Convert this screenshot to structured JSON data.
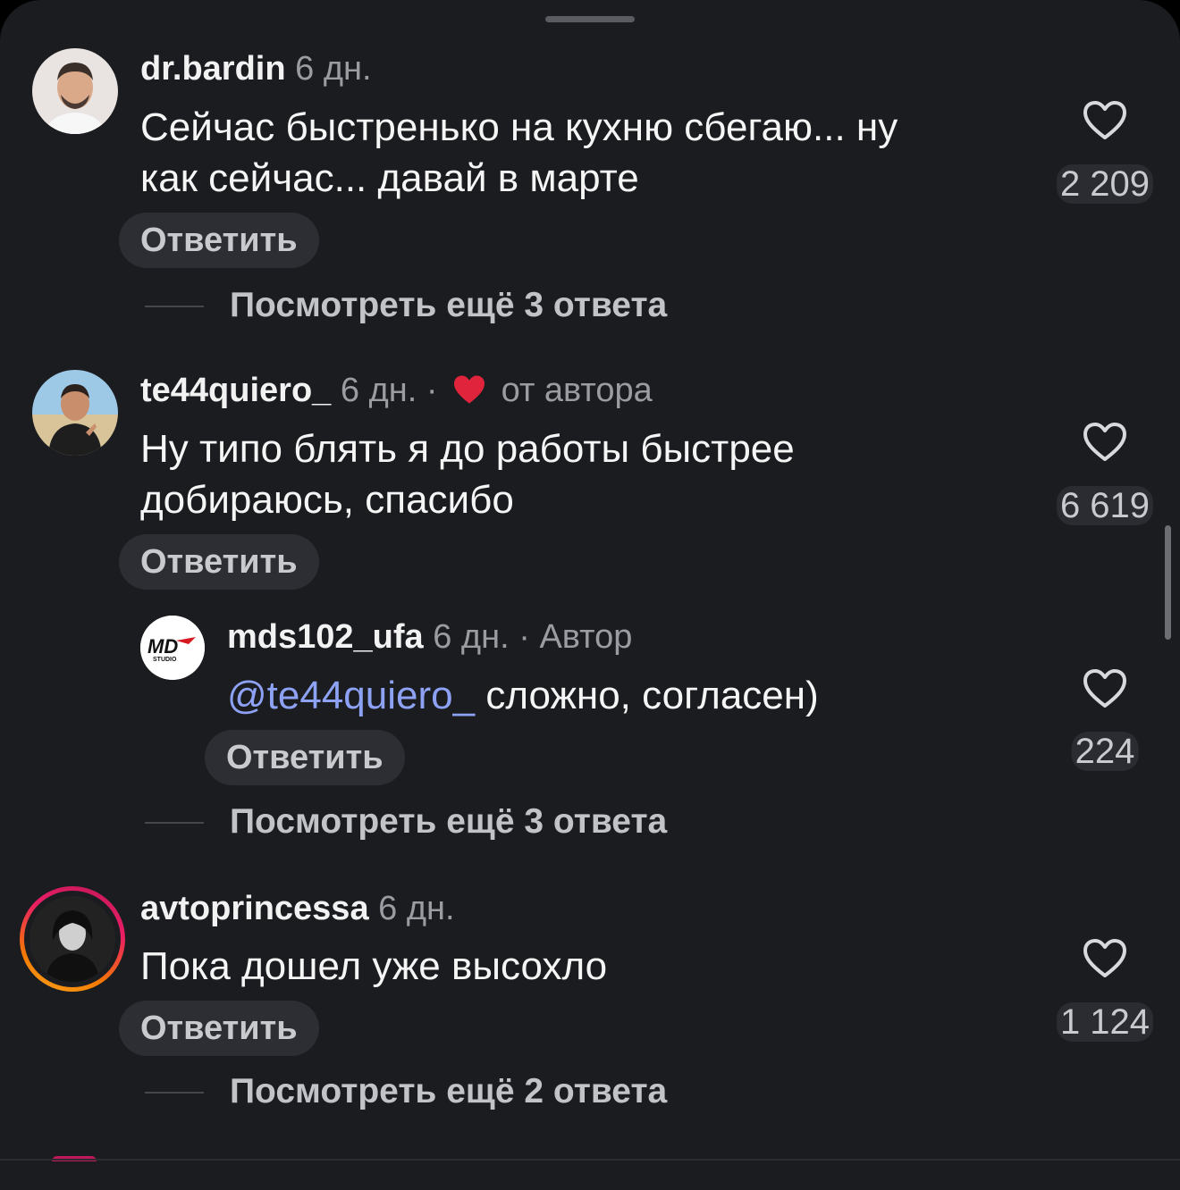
{
  "comments": [
    {
      "username": "dr.bardin",
      "time": "6 дн.",
      "text_line1": "Сейчас быстренько на кухню сбегаю... ну",
      "text_line2": "как сейчас... давай в марте",
      "likes": "2 209",
      "reply_label": "Ответить",
      "more_replies": "Посмотреть ещё 3 ответа"
    },
    {
      "username": "te44quiero_",
      "time": "6 дн.",
      "separator": "·",
      "author_like_label": "от автора",
      "text_line1": "Ну типо блять я до работы быстрее",
      "text_line2": "добираюсь, спасибо",
      "likes": "6 619",
      "reply_label": "Ответить",
      "reply": {
        "username": "mds102_ufa",
        "time": "6 дн.",
        "separator": "·",
        "badge": "Автор",
        "mention": "@te44quiero_",
        "text": " сложно, согласен)",
        "likes": "224",
        "reply_label": "Ответить"
      },
      "more_replies": "Посмотреть ещё 3 ответа"
    },
    {
      "username": "avtoprincessa",
      "time": "6 дн.",
      "text_line1": "Пока дошел уже высохло",
      "likes": "1 124",
      "reply_label": "Ответить",
      "more_replies": "Посмотреть ещё 2 ответа"
    }
  ],
  "logo_text": "MD",
  "logo_subtext": "STUDIO",
  "colors": {
    "background": "#1a1c20",
    "mention": "#8ea2f5",
    "heart_red": "#e0243b",
    "story_ring_start": "#f9a825",
    "story_ring_end": "#c2185b"
  }
}
